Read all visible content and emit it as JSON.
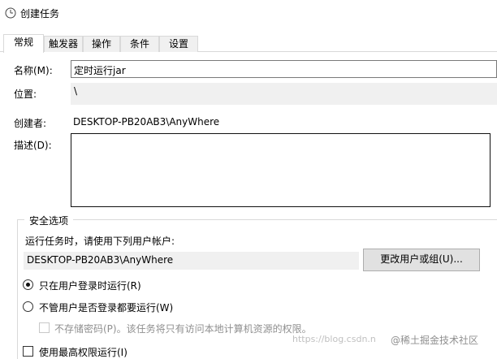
{
  "window": {
    "title": "创建任务"
  },
  "tabs": [
    {
      "label": "常规",
      "active": true
    },
    {
      "label": "触发器",
      "active": false
    },
    {
      "label": "操作",
      "active": false
    },
    {
      "label": "条件",
      "active": false
    },
    {
      "label": "设置",
      "active": false
    }
  ],
  "general": {
    "name_label": "名称(M):",
    "name_value": "定时运行jar",
    "location_label": "位置:",
    "location_value": "\\",
    "author_label": "创建者:",
    "author_value": "DESKTOP-PB20AB3\\AnyWhere",
    "description_label": "描述(D):",
    "description_value": ""
  },
  "security": {
    "group_title": "安全选项",
    "run_as_prompt": "运行任务时，请使用下列用户帐户:",
    "user_account": "DESKTOP-PB20AB3\\AnyWhere",
    "change_user_button": "更改用户或组(U)...",
    "radio_logged_on": "只在用户登录时运行(R)",
    "radio_logged_on_selected": true,
    "radio_whether_logged": "不管用户是否登录都要运行(W)",
    "radio_whether_logged_selected": false,
    "do_not_store_password": "不存储密码(P)。该任务将只有访问本地计算机资源的权限。",
    "highest_privileges": "使用最高权限运行(I)"
  },
  "watermark": {
    "url": "https://blog.csdn.n",
    "brand": "@稀土掘金技术社区"
  },
  "icons": {
    "title_icon": "clock-icon"
  }
}
